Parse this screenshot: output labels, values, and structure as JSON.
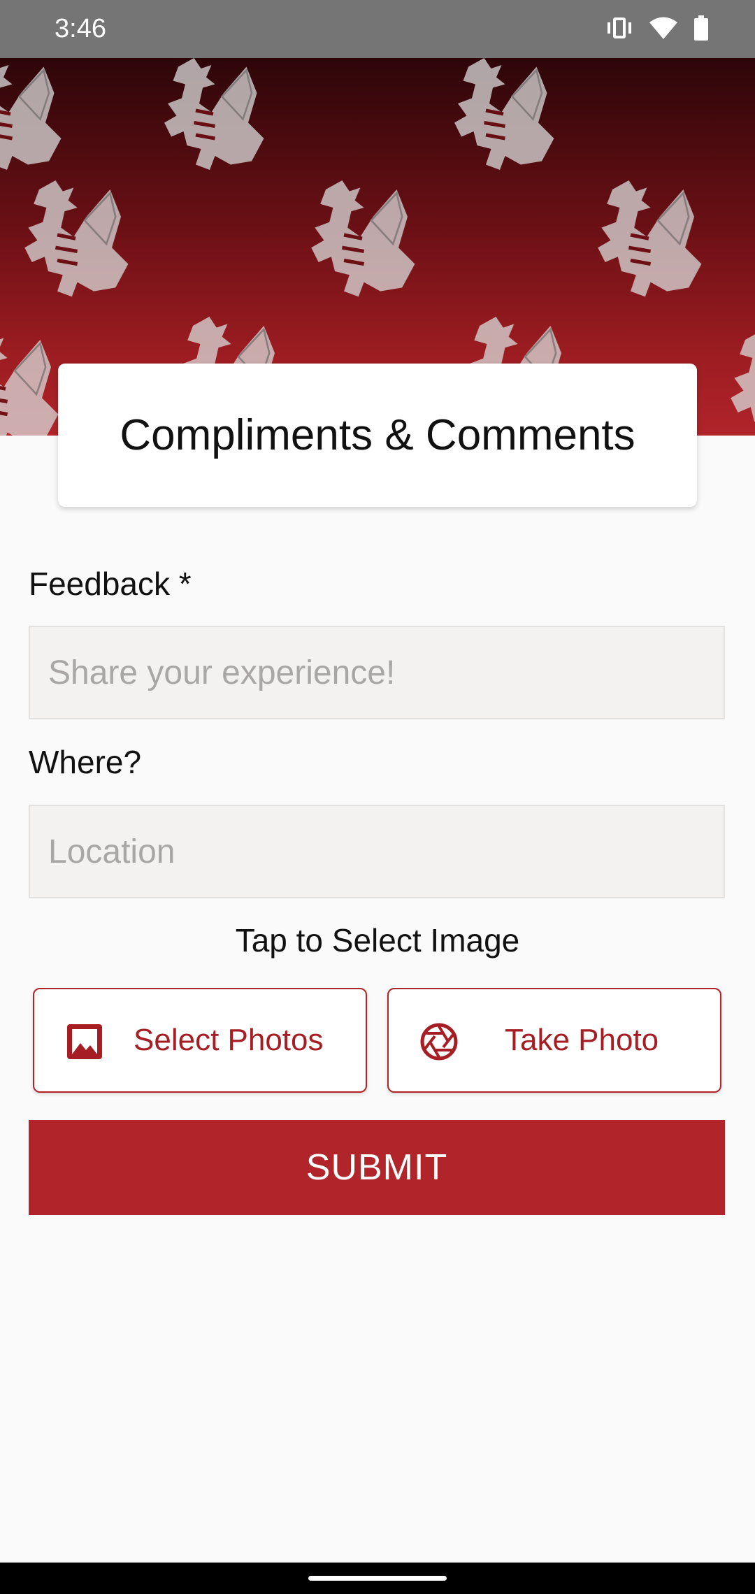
{
  "status_bar": {
    "time": "3:46",
    "icons": [
      "vibrate-icon",
      "wifi-icon",
      "battery-icon"
    ]
  },
  "header": {
    "title": "Compliments & Comments"
  },
  "form": {
    "feedback_label": "Feedback *",
    "feedback_placeholder": "Share your experience!",
    "feedback_value": "",
    "where_label": "Where?",
    "location_placeholder": "Location",
    "location_value": "",
    "image_prompt": "Tap to Select Image",
    "select_photos_label": "Select Photos",
    "take_photo_label": "Take Photo",
    "submit_label": "SUBMIT"
  },
  "colors": {
    "brand_red": "#b0242a",
    "status_bar": "#757575",
    "background": "#fafafa"
  }
}
